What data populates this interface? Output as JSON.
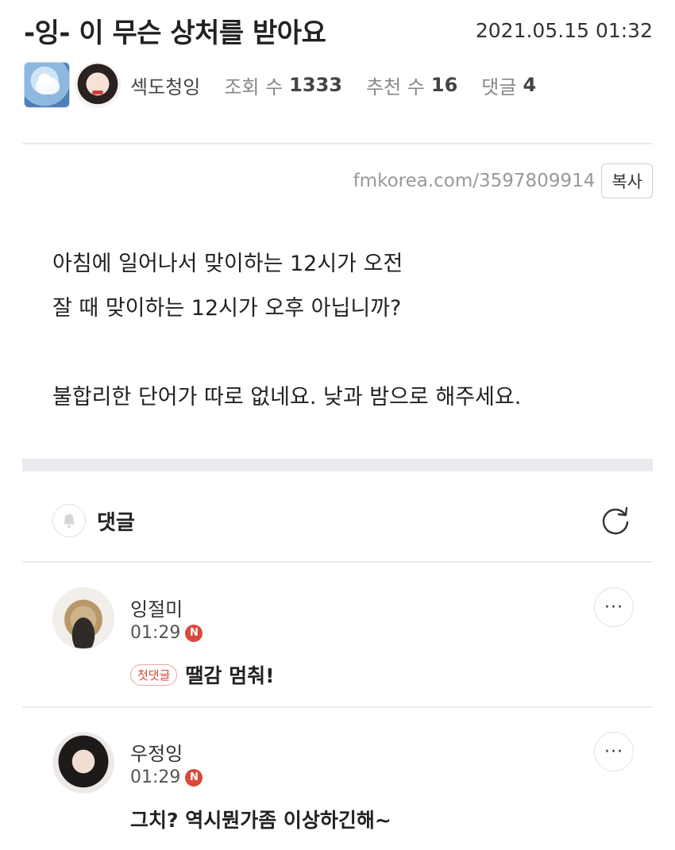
{
  "post": {
    "title": "-잉- 이 무슨 상처를 받아요",
    "datetime": "2021.05.15 01:32",
    "author": "섹도청잉",
    "views_label": "조회 수",
    "views": "1333",
    "recommend_label": "추천 수",
    "recommend": "16",
    "comments_label": "댓글",
    "comments": "4",
    "url": "fmkorea.com/3597809914",
    "copy_label": "복사",
    "content_lines": [
      "아침에 일어나서 맞이하는 12시가 오전",
      "잘 때 맞이하는 12시가 오후 아닙니까?",
      "불합리한 단어가 따로 없네요. 낮과 밤으로 해주세요."
    ]
  },
  "comments_section": {
    "title": "댓글",
    "items": [
      {
        "author": "잉절미",
        "time": "01:29",
        "new_badge": "N",
        "first_badge": "첫댓글",
        "text": "땔감 멈춰!",
        "more": "···"
      },
      {
        "author": "우정잉",
        "time": "01:29",
        "new_badge": "N",
        "text": "그치? 역시뭔가좀 이상하긴해~",
        "more": "···"
      }
    ]
  },
  "icons": {
    "bell": "bell-icon",
    "refresh": "refresh-icon",
    "more": "more-icon"
  },
  "colors": {
    "accent_red": "#d9483b",
    "divider": "#ececec",
    "section_band": "#e9e9ee"
  }
}
